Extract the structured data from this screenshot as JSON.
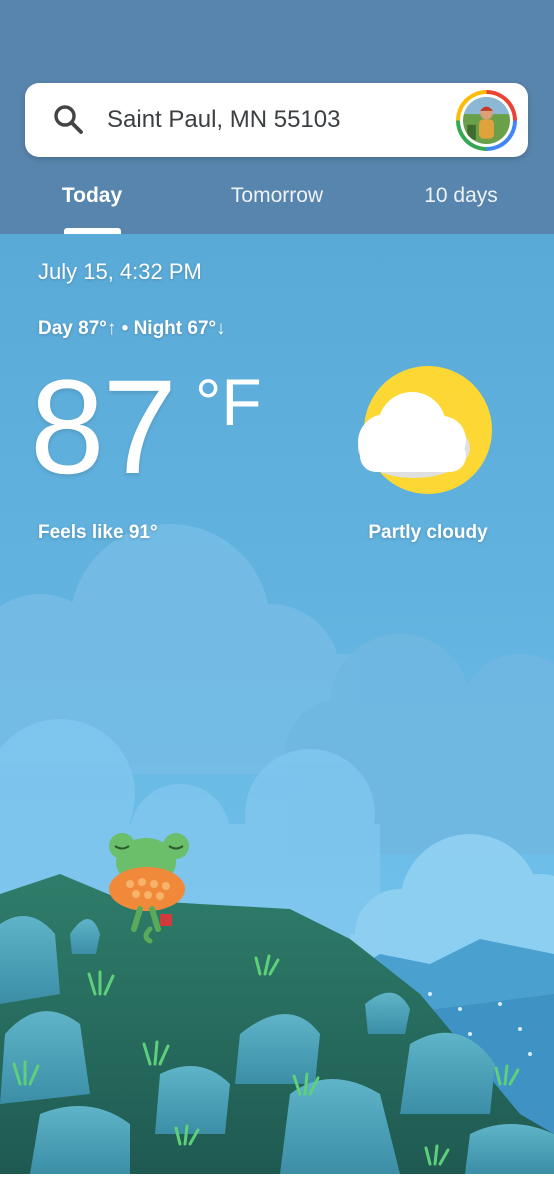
{
  "search": {
    "location": "Saint Paul, MN 55103",
    "icon": "search-icon",
    "avatar_icon": "account-avatar"
  },
  "tabs": [
    {
      "label": "Today",
      "selected": true
    },
    {
      "label": "Tomorrow",
      "selected": false
    },
    {
      "label": "10 days",
      "selected": false
    }
  ],
  "current": {
    "datetime": "July 15, 4:32 PM",
    "hilo": "Day 87°↑ • Night 67°↓",
    "temperature": "87",
    "unit": "°F",
    "feels_like": "Feels like 91°",
    "condition": "Partly cloudy",
    "condition_icon": "partly-cloudy-icon"
  },
  "colors": {
    "header": "#5885ad",
    "sky": "#5aaad8",
    "sun": "#fdd835"
  }
}
